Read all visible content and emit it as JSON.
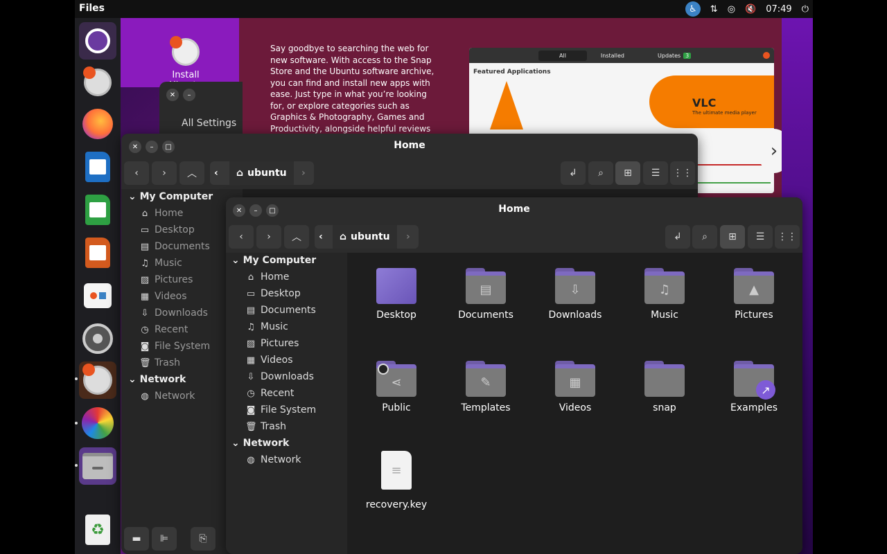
{
  "topbar": {
    "app_name": "Files",
    "time": "07:49"
  },
  "dock": {
    "items": [
      "Ubuntu",
      "Install Ubuntu",
      "Firefox",
      "Writer",
      "Calc",
      "Impress",
      "App Center",
      "Settings",
      "Installer",
      "Color",
      "Files",
      "Trash"
    ]
  },
  "desktop": {
    "install_label": "Install Ubuntu"
  },
  "settings_window": {
    "label": "All Settings"
  },
  "snap_store": {
    "promo_text": "Say goodbye to searching the web for new software. With access to the Snap Store and the Ubuntu software archive, you can find and install new apps with ease. Just type in what you’re looking for, or explore categories such as Graphics & Photography, Games and Productivity, alongside helpful reviews",
    "tab_all": "All",
    "tab_installed": "Installed",
    "tab_updates": "Updates",
    "updates_count": "3",
    "featured": "Featured Applications",
    "vlc": "VLC",
    "vlc_sub": "The ultimate media player",
    "cat1": "ductivity",
    "cat2": "ons"
  },
  "back_window": {
    "title": "Home",
    "path": "ubuntu",
    "sidebar": {
      "my_computer": "My Computer",
      "items": [
        "Home",
        "Desktop",
        "Documents",
        "Music",
        "Pictures",
        "Videos",
        "Downloads",
        "Recent",
        "File System",
        "Trash"
      ],
      "network_head": "Network",
      "network_item": "Network"
    }
  },
  "front_window": {
    "title": "Home",
    "path": "ubuntu",
    "sidebar": {
      "my_computer": "My Computer",
      "items": [
        "Home",
        "Desktop",
        "Documents",
        "Music",
        "Pictures",
        "Videos",
        "Downloads",
        "Recent",
        "File System",
        "Trash"
      ],
      "network_head": "Network",
      "network_item": "Network"
    },
    "files": [
      "Desktop",
      "Documents",
      "Downloads",
      "Music",
      "Pictures",
      "Public",
      "Templates",
      "Videos",
      "snap",
      "Examples",
      "recovery.key"
    ]
  },
  "colors": {
    "folder_accent": "#7e6ac0",
    "window_bg": "#1e1e1e",
    "sidebar_bg": "#262626"
  }
}
